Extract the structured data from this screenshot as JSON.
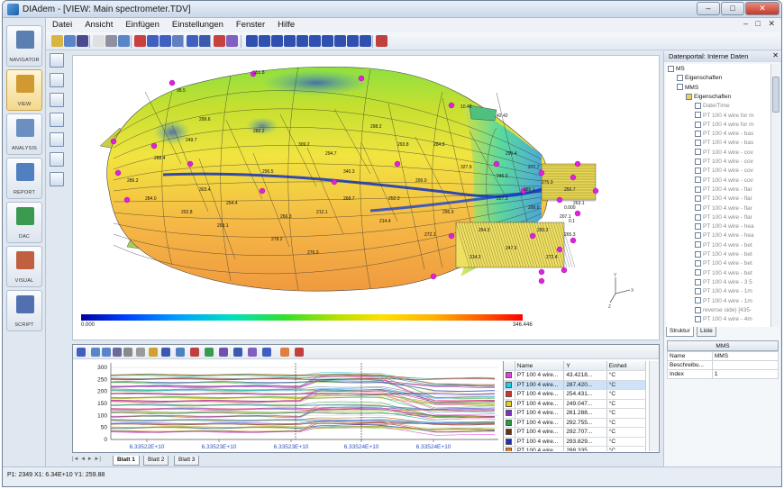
{
  "window": {
    "title": "DIAdem - [VIEW:  Main spectrometer.TDV]",
    "min": "–",
    "max": "□",
    "close": "✕"
  },
  "menu": [
    "Datei",
    "Ansicht",
    "Einfügen",
    "Einstellungen",
    "Fenster",
    "Hilfe"
  ],
  "mdi_buttons": "– □ ✕",
  "nav": [
    {
      "label": "NAVIGATOR",
      "icon": "navigator-icon"
    },
    {
      "label": "VIEW",
      "icon": "view-icon",
      "active": true
    },
    {
      "label": "ANALYSIS",
      "icon": "analysis-icon"
    },
    {
      "label": "REPORT",
      "icon": "report-icon"
    },
    {
      "label": "DAC",
      "icon": "dac-icon"
    },
    {
      "label": "VISUAL",
      "icon": "visual-icon"
    },
    {
      "label": "SCRIPT",
      "icon": "script-icon"
    }
  ],
  "view3d": {
    "colorbar_min": "0.000",
    "colorbar_max": "346.446",
    "axes": {
      "y": "Y",
      "x": "X",
      "z": "Z"
    },
    "labels": [
      "98.5",
      "351.8",
      "10.42",
      "299.6",
      "282.2",
      "296.5",
      "294.7",
      "298.2",
      "284.8",
      "327.9",
      "290.4",
      "285.1",
      "286.2",
      "284.0",
      "202.8",
      "293.1",
      "278.2",
      "276.3",
      "268.7",
      "214.4",
      "299.0",
      "296.9",
      "264.3",
      "227.3",
      "200.0",
      "288.4",
      "303.4",
      "309.2",
      "340.3",
      "293.8",
      "272.1",
      "314.3",
      "247.6",
      "250.2",
      "272.4",
      "207.1",
      "265.3",
      "263.1",
      "250.7",
      "277.7",
      "275.3",
      "246.3",
      "252.3",
      "212.1",
      "266.3",
      "254.4",
      "249.7",
      "42.42",
      "0.1",
      "0.000"
    ]
  },
  "chart": {
    "y_ticks": [
      "300",
      "250",
      "200",
      "150",
      "100",
      "50",
      "0"
    ],
    "x_ticks": [
      "6.33522E+10",
      "6.33523E+10",
      "6.33523E+10",
      "6.33524E+10",
      "6.33524E+10"
    ],
    "table": {
      "headers": [
        "",
        "Name",
        "Y",
        "Einheit"
      ],
      "rows": [
        {
          "color": "#e040e0",
          "name": "PT 100 4 wire...",
          "y": "43.4218...",
          "unit": "°C"
        },
        {
          "color": "#20d0e0",
          "name": "PT 100 4 wire...",
          "y": "287.420...",
          "unit": "°C",
          "selected": true
        },
        {
          "color": "#d03030",
          "name": "PT 100 4 wire...",
          "y": "254.431...",
          "unit": "°C"
        },
        {
          "color": "#e0d020",
          "name": "PT 100 4 wire...",
          "y": "249.047...",
          "unit": "°C"
        },
        {
          "color": "#8030c0",
          "name": "PT 100 4 wire...",
          "y": "261.288...",
          "unit": "°C"
        },
        {
          "color": "#20a040",
          "name": "PT 100 4 wire...",
          "y": "292.755...",
          "unit": "°C"
        },
        {
          "color": "#703010",
          "name": "PT 100 4 wire...",
          "y": "292.707...",
          "unit": "°C"
        },
        {
          "color": "#2030c0",
          "name": "PT 100 4 wire...",
          "y": "293.829...",
          "unit": "°C"
        },
        {
          "color": "#e08020",
          "name": "PT 100 4 wire...",
          "y": "288.335...",
          "unit": "°C"
        }
      ]
    }
  },
  "sheets": {
    "nav": "|◄ ◄ ► ►|",
    "tabs": [
      "Blatt 1",
      "Blatt 2",
      "Blatt 3"
    ]
  },
  "portal": {
    "title": "Datenportal: Interne Daten",
    "close": "✕",
    "tree": [
      {
        "t": "MS",
        "l": 0
      },
      {
        "t": "Eigenschaften",
        "l": 1
      },
      {
        "t": "MMS",
        "l": 1
      },
      {
        "t": "Eigenschaften",
        "l": 2
      },
      {
        "t": "Date/Time",
        "l": 3
      },
      {
        "t": "PT 100 4 wire for m",
        "l": 3
      },
      {
        "t": "PT 100 4 wire for m",
        "l": 3
      },
      {
        "t": "PT 100 4 wire - bas",
        "l": 3
      },
      {
        "t": "PT 100 4 wire - bas",
        "l": 3
      },
      {
        "t": "PT 100 4 wire - cov",
        "l": 3
      },
      {
        "t": "PT 100 4 wire - cov",
        "l": 3
      },
      {
        "t": "PT 100 4 wire - cov",
        "l": 3
      },
      {
        "t": "PT 100 4 wire - cov",
        "l": 3
      },
      {
        "t": "PT 100 4 wire - flar",
        "l": 3
      },
      {
        "t": "PT 100 4 wire - flar",
        "l": 3
      },
      {
        "t": "PT 100 4 wire - flar",
        "l": 3
      },
      {
        "t": "PT 100 4 wire - flar",
        "l": 3
      },
      {
        "t": "PT 100 4 wire - hea",
        "l": 3
      },
      {
        "t": "PT 100 4 wire - hea",
        "l": 3
      },
      {
        "t": "PT 100 4 wire - bet",
        "l": 3
      },
      {
        "t": "PT 100 4 wire - bet",
        "l": 3
      },
      {
        "t": "PT 100 4 wire - bet",
        "l": 3
      },
      {
        "t": "PT 100 4 wire - bet",
        "l": 3
      },
      {
        "t": "PT 100 4 wire - 3 5",
        "l": 3
      },
      {
        "t": "PT 100 4 wire - 1m",
        "l": 3
      },
      {
        "t": "PT 100 4 wire - 1m",
        "l": 3
      },
      {
        "t": "reverse side) [435-",
        "l": 3
      },
      {
        "t": "PT 100 4 wire - 4m",
        "l": 3
      }
    ],
    "tabs": [
      "Struktur",
      "Liste"
    ],
    "props": {
      "header": "MMS",
      "rows": [
        [
          "Name",
          "MMS"
        ],
        [
          "Beschreibu...",
          ""
        ],
        [
          "Index",
          "1"
        ]
      ]
    }
  },
  "status": "P1: 2349 X1:  6.34E+10 Y1:  259.88"
}
